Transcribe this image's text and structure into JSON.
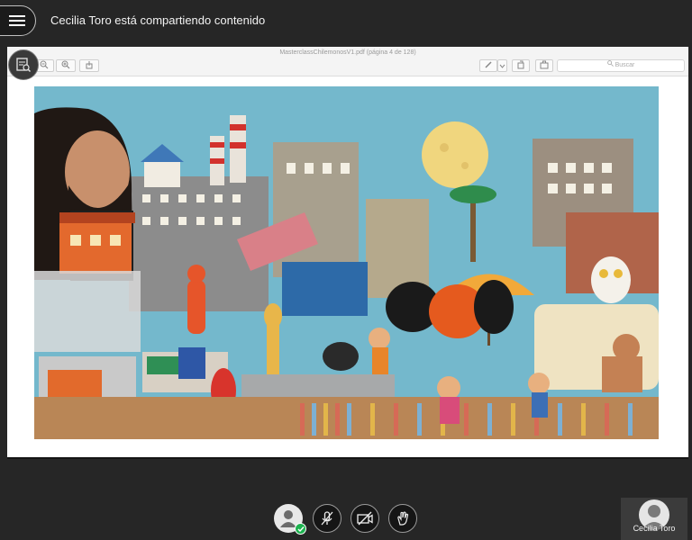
{
  "header": {
    "menu_icon": "hamburger-menu-icon",
    "share_title": "Cecilia Toro está compartiendo contenido"
  },
  "viewer": {
    "document_title": "MasterclassChilemonosV1.pdf (página 4 de 128)",
    "search_placeholder": "Buscar",
    "annotation_tool_icon": "annotation-tool-icon"
  },
  "controls": {
    "avatar_icon": "user-avatar-icon",
    "status_icon": "checkmark-icon",
    "mic_icon": "microphone-off-icon",
    "camera_icon": "camera-off-icon",
    "hand_icon": "raise-hand-icon"
  },
  "participant": {
    "name": "Cecilia Toro"
  }
}
